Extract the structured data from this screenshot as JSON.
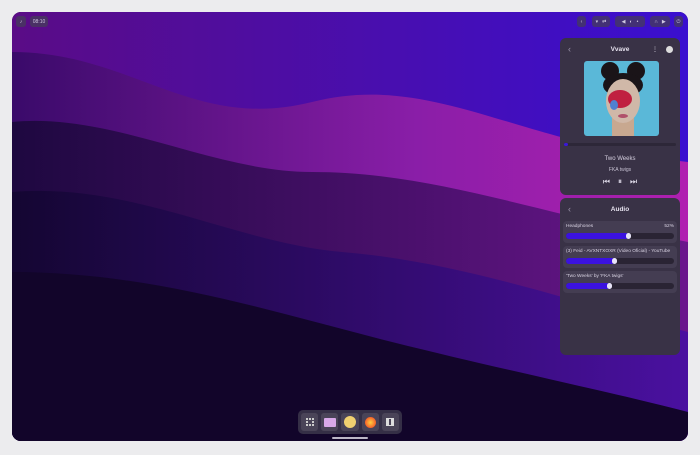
{
  "topbar": {
    "notification_icon": "bell-icon",
    "clock": "08:10",
    "icons": [
      "chevron-left-icon",
      "wifi-icon",
      "transfer-icon",
      "volume-icon",
      "brightness-icon",
      "mic-icon",
      "headphones-icon",
      "play-icon",
      "power-icon"
    ]
  },
  "player": {
    "title": "Vvave",
    "song": "Two Weeks",
    "artist": "FKA twigs",
    "progress": 0.04,
    "prev": "⏮",
    "pause": "⏸",
    "next": "⏭"
  },
  "audio": {
    "title": "Audio",
    "items": [
      {
        "label": "Headphones",
        "percent": "52%",
        "value": 0.58
      },
      {
        "label": "(3) Feid - AVXNTXOXR (Video Oficial) - YouTube",
        "value": 0.45
      },
      {
        "label": "'Two Weeks' by 'FKA twigs'",
        "value": 0.41
      }
    ]
  },
  "dock": {
    "items": [
      "window-switcher-icon",
      "file-manager-icon",
      "emoji-icon",
      "firefox-icon",
      "sidebar-icon"
    ]
  },
  "colors": {
    "accent": "#3b12e0",
    "panel": "#393246"
  }
}
